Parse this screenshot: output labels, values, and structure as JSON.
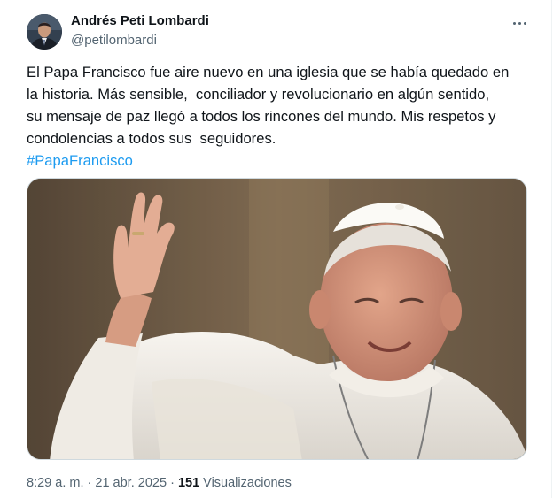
{
  "author": {
    "name": "Andrés Peti Lombardi",
    "handle": "@petilombardi"
  },
  "menu_icon": "more-horizontal-icon",
  "tweet": {
    "lines": [
      "El Papa Francisco fue aire nuevo en una iglesia que se había quedado en",
      "la historia. Más sensible,  conciliador y revolucionario en algún sentido,",
      "su mensaje de paz llegó a todos los rincones del mundo. Mis respetos y",
      "condolencias a todos sus  seguidores."
    ],
    "hashtag": "#PapaFrancisco"
  },
  "media": {
    "subject": "Pope Francis in white cassock and zucchetto waving with right hand"
  },
  "meta": {
    "time": "8:29 a. m.",
    "separator": "·",
    "date": "21 abr. 2025",
    "views_count": "151",
    "views_label": "Visualizaciones"
  },
  "colors": {
    "accent": "#1d9bf0",
    "text_primary": "#0f1419",
    "text_secondary": "#536471",
    "border": "#cfd9de"
  }
}
